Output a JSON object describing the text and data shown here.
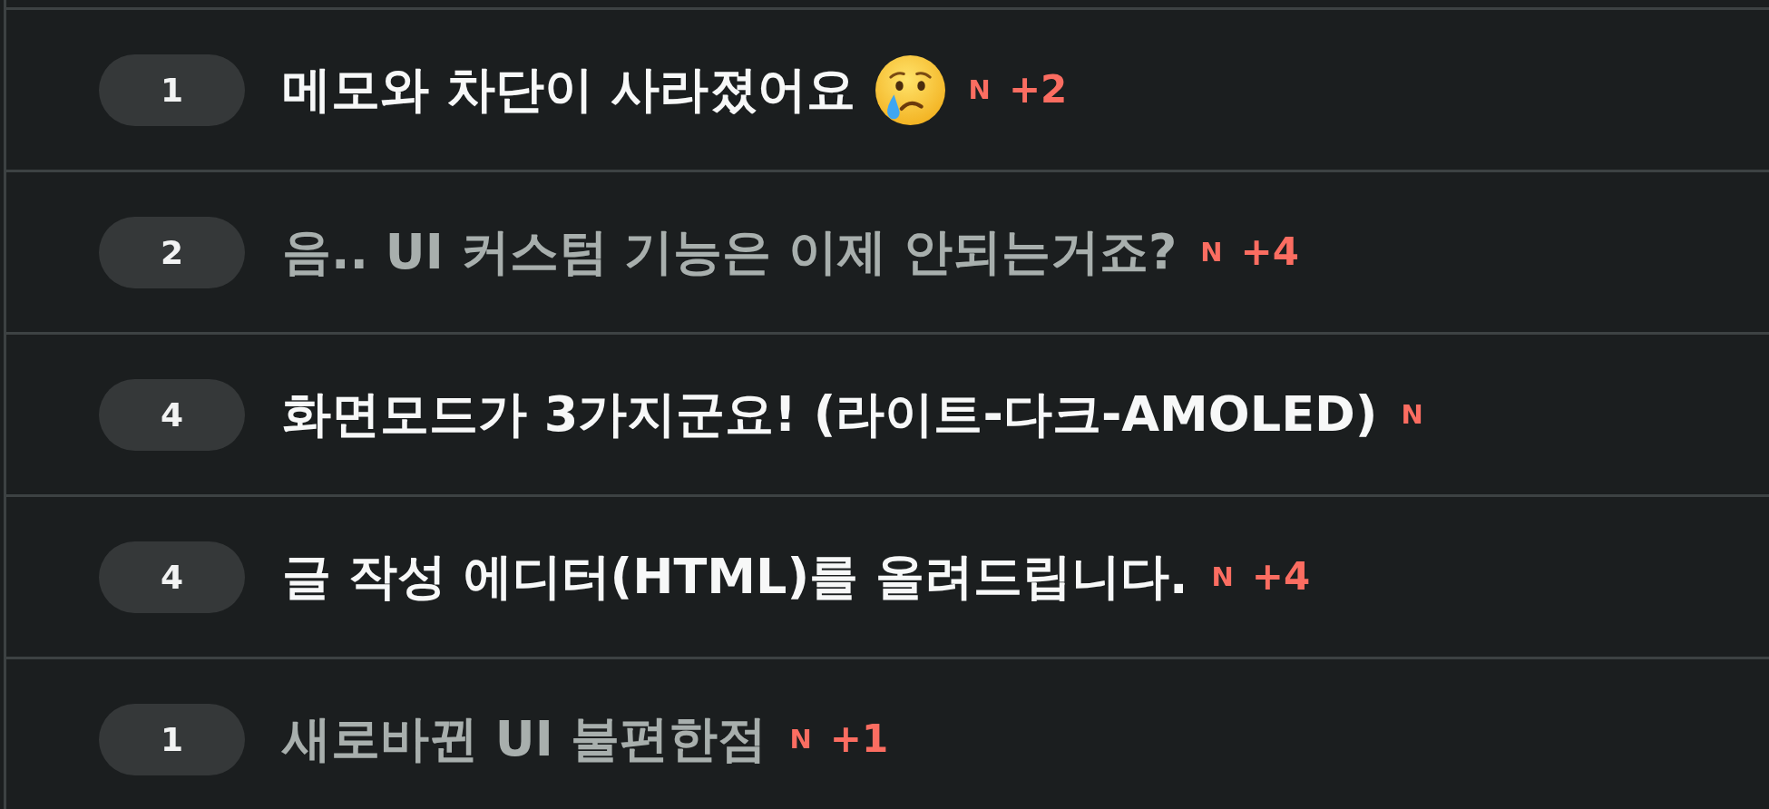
{
  "posts": [
    {
      "number": "1",
      "title": "메모와 차단이 사라졌어요",
      "emoji": true,
      "read": false,
      "new_label": "N",
      "comments": "+2"
    },
    {
      "number": "2",
      "title": "음.. UI 커스텀 기능은 이제 안되는거죠?",
      "emoji": false,
      "read": true,
      "new_label": "N",
      "comments": "+4"
    },
    {
      "number": "4",
      "title": "화면모드가 3가지군요! (라이트-다크-AMOLED)",
      "emoji": false,
      "read": false,
      "new_label": "N"
    },
    {
      "number": "4",
      "title": "글 작성 에디터(HTML)를 올려드립니다.",
      "emoji": false,
      "read": false,
      "new_label": "N",
      "comments": "+4"
    },
    {
      "number": "1",
      "title": "새로바뀐 UI 불편한점",
      "emoji": false,
      "read": true,
      "new_label": "N",
      "comments": "+1"
    }
  ]
}
